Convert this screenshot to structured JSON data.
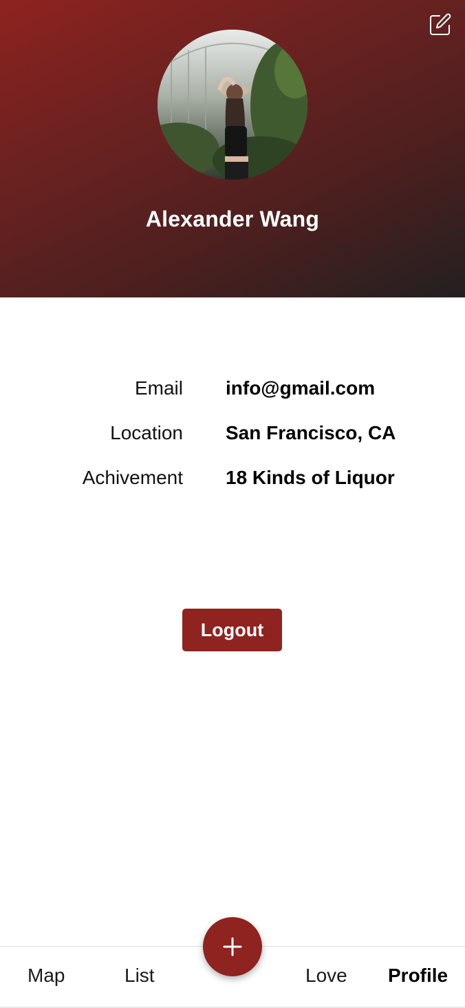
{
  "profile": {
    "name": "Alexander Wang"
  },
  "info": {
    "rows": [
      {
        "label": "Email",
        "value": "info@gmail.com"
      },
      {
        "label": "Location",
        "value": "San Francisco, CA"
      },
      {
        "label": "Achivement",
        "value": "18 Kinds of Liquor"
      }
    ]
  },
  "actions": {
    "logout_label": "Logout"
  },
  "nav": {
    "items": [
      {
        "label": "Map"
      },
      {
        "label": "List"
      },
      {
        "label": "Love"
      },
      {
        "label": "Profile"
      }
    ],
    "active": "Profile"
  },
  "icons": {
    "edit": "edit-icon",
    "add": "plus-icon"
  },
  "colors": {
    "accent": "#8e2320",
    "header_dark": "#232020"
  }
}
